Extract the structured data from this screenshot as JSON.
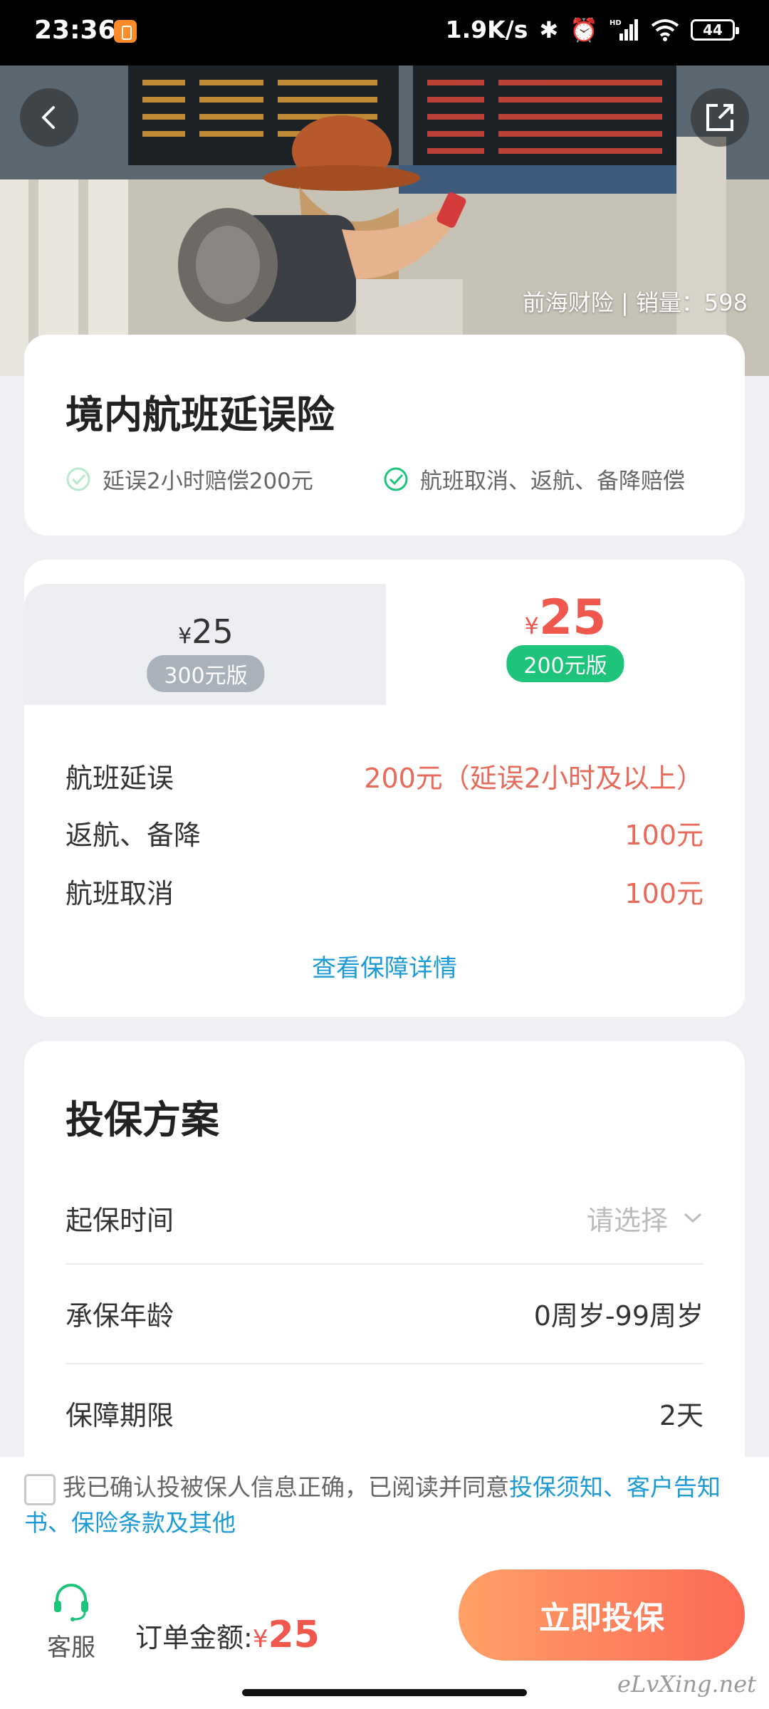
{
  "status_bar": {
    "time": "23:36",
    "network_speed": "1.9K/s",
    "signal_label": "HD",
    "battery": "44"
  },
  "hero": {
    "sales_text": "前海财险 | 销量：598",
    "back_icon": "chevron-left-icon",
    "share_icon": "share-icon"
  },
  "product": {
    "title": "境内航班延误险",
    "features": [
      "延误2小时赔偿200元",
      "航班取消、返航、备降赔偿"
    ]
  },
  "plans": {
    "currency": "¥",
    "left": {
      "price": "25",
      "version": "300元版"
    },
    "right": {
      "price": "25",
      "version": "200元版"
    }
  },
  "coverage": {
    "rows": [
      {
        "label": "航班延误",
        "value": "200元（延误2小时及以上）"
      },
      {
        "label": "返航、备降",
        "value": "100元"
      },
      {
        "label": "航班取消",
        "value": "100元"
      }
    ],
    "details_link": "查看保障详情"
  },
  "insure_plan": {
    "title": "投保方案",
    "start_time": {
      "label": "起保时间",
      "placeholder": "请选择"
    },
    "age": {
      "label": "承保年龄",
      "value": "0周岁-99周岁"
    },
    "period": {
      "label": "保障期限",
      "value": "2天"
    }
  },
  "agreement": {
    "text": "我已确认投被保人信息正确，已阅读并同意",
    "links": "投保须知、客户告知书、保险条款及其他"
  },
  "bottom": {
    "service_label": "客服",
    "order_label": "订单金额:",
    "currency": "¥",
    "amount": "25",
    "submit_label": "立即投保"
  },
  "watermark": "eLvXing.net",
  "colors": {
    "accent_red": "#f0584e",
    "accent_green": "#1dc47a",
    "link_blue": "#1c9ad6"
  }
}
